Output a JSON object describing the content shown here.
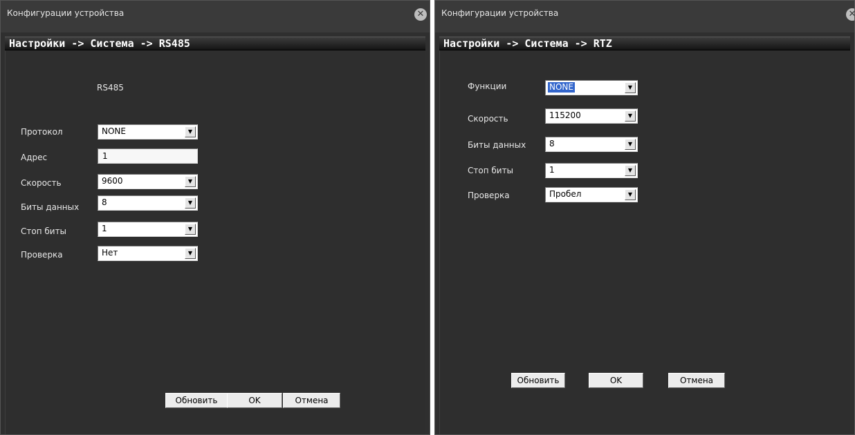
{
  "left_window": {
    "title": "Конфигурации устройства",
    "breadcrumb": "Настройки -> Система -> RS485",
    "section_title": "RS485",
    "fields": {
      "protocol": {
        "label": "Протокол",
        "value": "NONE"
      },
      "address": {
        "label": "Адрес",
        "value": "1"
      },
      "speed": {
        "label": "Скорость",
        "value": "9600"
      },
      "data_bits": {
        "label": "Биты данных",
        "value": "8"
      },
      "stop_bits": {
        "label": "Стоп биты",
        "value": "1"
      },
      "parity": {
        "label": "Проверка",
        "value": "Нет"
      }
    },
    "buttons": {
      "refresh": "Обновить",
      "ok": "OK",
      "cancel": "Отмена"
    }
  },
  "right_window": {
    "title": "Конфигурации устройства",
    "breadcrumb": "Настройки -> Система -> RTZ",
    "fields": {
      "function": {
        "label": "Функции",
        "value": "NONE"
      },
      "speed": {
        "label": "Скорость",
        "value": "115200"
      },
      "data_bits": {
        "label": "Биты данных",
        "value": "8"
      },
      "stop_bits": {
        "label": "Стоп биты",
        "value": "1"
      },
      "parity": {
        "label": "Проверка",
        "value": "Пробел"
      }
    },
    "buttons": {
      "refresh": "Обновить",
      "ok": "OK",
      "cancel": "Отмена"
    }
  },
  "icons": {
    "close": "close-icon",
    "dropdown": "chevron-down-icon"
  }
}
